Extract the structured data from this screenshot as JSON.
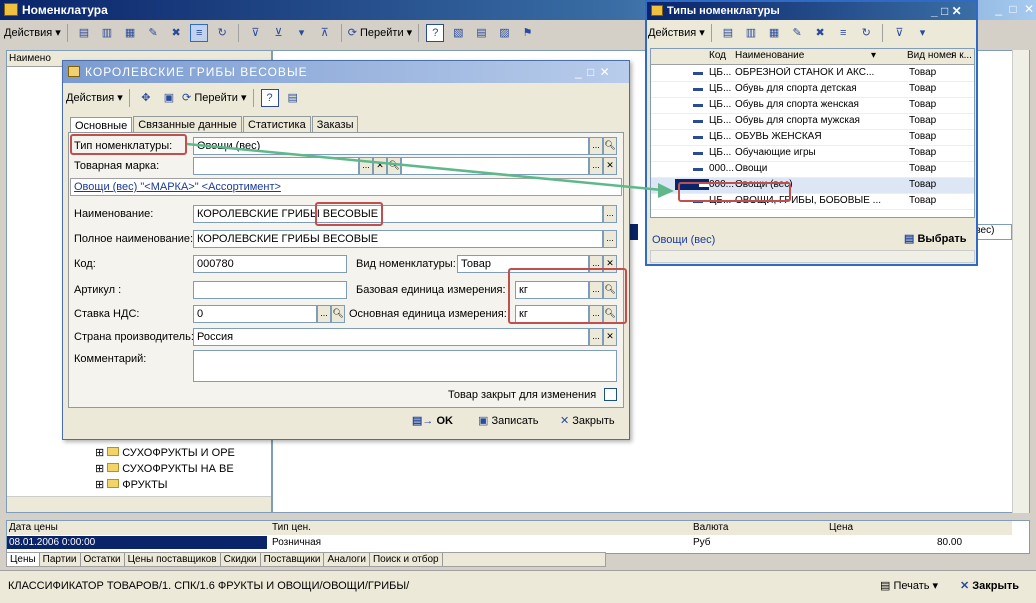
{
  "main": {
    "title": "Номенклатура",
    "menu_actions": "Действия",
    "goto": "Перейти",
    "tree_header": "Наимено",
    "tree_items": [
      "СУХОФРУКТЫ И ОРЕ",
      "СУХОФРУКТЫ НА ВЕ",
      "ФРУКТЫ"
    ],
    "bottom_headers": {
      "price_date": "Дата цены",
      "price_type": "Тип цен.",
      "currency": "Валюта",
      "price": "Цена"
    },
    "bottom_row": {
      "price_date": "08.01.2006 0:00:00",
      "price_type": "Розничная",
      "currency": "Руб",
      "price": "80.00"
    },
    "bottom_tabs": [
      "Цены",
      "Партии",
      "Остатки",
      "Цены поставщиков",
      "Скидки",
      "Поставщики",
      "Аналоги",
      "Поиск и отбор"
    ],
    "status_path": "КЛАССИФИКАТОР ТОВАРОВ/1. СПК/1.6 ФРУКТЫ И ОВОЩИ/ОВОЩИ/ГРИБЫ/",
    "print": "Печать",
    "close": "Закрыть",
    "right_fragment": "(вес)"
  },
  "item_form": {
    "title": "КОРОЛЕВСКИЕ ГРИБЫ ВЕСОВЫЕ",
    "actions": "Действия",
    "goto": "Перейти",
    "tabs": [
      "Основные",
      "Связанные данные",
      "Статистика",
      "Заказы"
    ],
    "type_label": "Тип номенклатуры:",
    "type_value": "Овощи (вес)",
    "brand_label": "Товарная марка:",
    "brand_value": "",
    "link_text": "Овощи (вес) \"<МАРКА>\" <Ассортимент>",
    "name_label": "Наименование:",
    "name_value": "КОРОЛЕВСКИЕ ГРИБЫ ВЕСОВЫЕ",
    "fullname_label": "Полное наименование:",
    "fullname_value": "КОРОЛЕВСКИЕ ГРИБЫ ВЕСОВЫЕ",
    "code_label": "Код:",
    "code_value": "000780",
    "kind_label": "Вид номенклатуры:",
    "kind_value": "Товар",
    "article_label": "Артикул :",
    "article_value": "",
    "base_unit_label": "Базовая единица измерения:",
    "base_unit_value": "кг",
    "vat_label": "Ставка НДС:",
    "vat_value": "0",
    "main_unit_label": "Основная единица измерения:",
    "main_unit_value": "кг",
    "country_label": "Страна производитель:",
    "country_value": "Россия",
    "comment_label": "Комментарий:",
    "comment_value": "",
    "closed_label": "Товар закрыт для изменения",
    "ok": "OK",
    "save": "Записать",
    "close": "Закрыть"
  },
  "types_window": {
    "title": "Типы номенклатуры",
    "actions": "Действия",
    "col_code": "Код",
    "col_name": "Наименование",
    "col_kind": "Вид номенклатуры",
    "col_extra": "я к...",
    "rows": [
      {
        "code": "ЦБ...",
        "name": "ОБРЕЗНОЙ СТАНОК И АКС...",
        "kind": "Товар"
      },
      {
        "code": "ЦБ...",
        "name": "Обувь для спорта детская",
        "kind": "Товар"
      },
      {
        "code": "ЦБ...",
        "name": "Обувь для спорта женская",
        "kind": "Товар"
      },
      {
        "code": "ЦБ...",
        "name": "Обувь для спорта мужская",
        "kind": "Товар"
      },
      {
        "code": "ЦБ...",
        "name": "ОБУВЬ ЖЕНСКАЯ",
        "kind": "Товар"
      },
      {
        "code": "ЦБ...",
        "name": "Обучающие игры",
        "kind": "Товар"
      },
      {
        "code": "000...",
        "name": "Овощи",
        "kind": "Товар"
      },
      {
        "code": "000...",
        "name": "Овощи (вес)",
        "kind": "Товар"
      },
      {
        "code": "ЦБ...",
        "name": "ОВОЩИ, ГРИБЫ, БОБОВЫЕ ...",
        "kind": "Товар"
      }
    ],
    "footer_value": "Овощи (вес)",
    "select": "Выбрать"
  },
  "colors": {
    "title_grad_start": "#0a246a",
    "title_grad_end": "#a6caf0",
    "highlight": "#c05050",
    "arrow": "#5fb88a"
  }
}
